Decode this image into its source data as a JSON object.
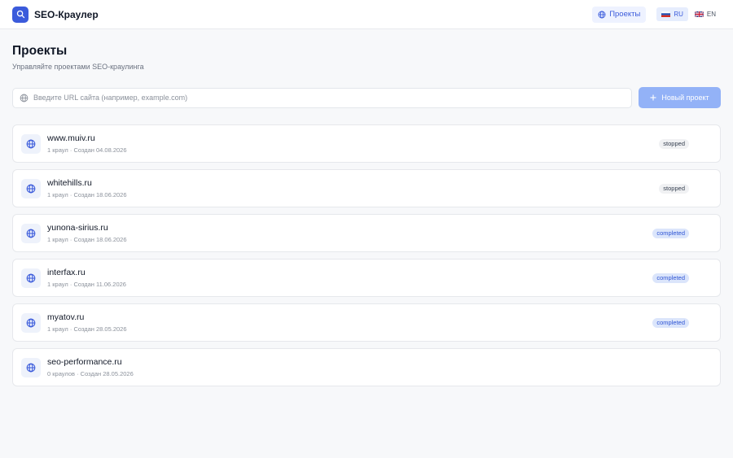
{
  "header": {
    "app_title": "SEO-Краулер",
    "nav_projects_label": "Проекты",
    "languages": [
      {
        "code": "RU",
        "active": true
      },
      {
        "code": "EN",
        "active": false
      }
    ]
  },
  "page": {
    "title": "Проекты",
    "subtitle": "Управляйте проектами SEO-краулинга"
  },
  "search": {
    "placeholder": "Введите URL сайта (например, example.com)",
    "value": ""
  },
  "new_project_label": "Новый проект",
  "projects": [
    {
      "domain": "www.muiv.ru",
      "crawls": "1 краул",
      "created": "Создан 04.08.2026",
      "status": "stopped"
    },
    {
      "domain": "whitehills.ru",
      "crawls": "1 краул",
      "created": "Создан 18.06.2026",
      "status": "stopped"
    },
    {
      "domain": "yunona-sirius.ru",
      "crawls": "1 краул",
      "created": "Создан 18.06.2026",
      "status": "completed"
    },
    {
      "domain": "interfax.ru",
      "crawls": "1 краул",
      "created": "Создан 11.06.2026",
      "status": "completed"
    },
    {
      "domain": "myatov.ru",
      "crawls": "1 краул",
      "created": "Создан 28.05.2026",
      "status": "completed"
    },
    {
      "domain": "seo-performance.ru",
      "crawls": "0 краулов",
      "created": "Создан 28.05.2026",
      "status": ""
    }
  ],
  "colors": {
    "accent": "#3b5bdb",
    "button": "#93b2f7",
    "badge_completed_bg": "#dbe5fb",
    "badge_stopped_bg": "#f0f1f3"
  }
}
